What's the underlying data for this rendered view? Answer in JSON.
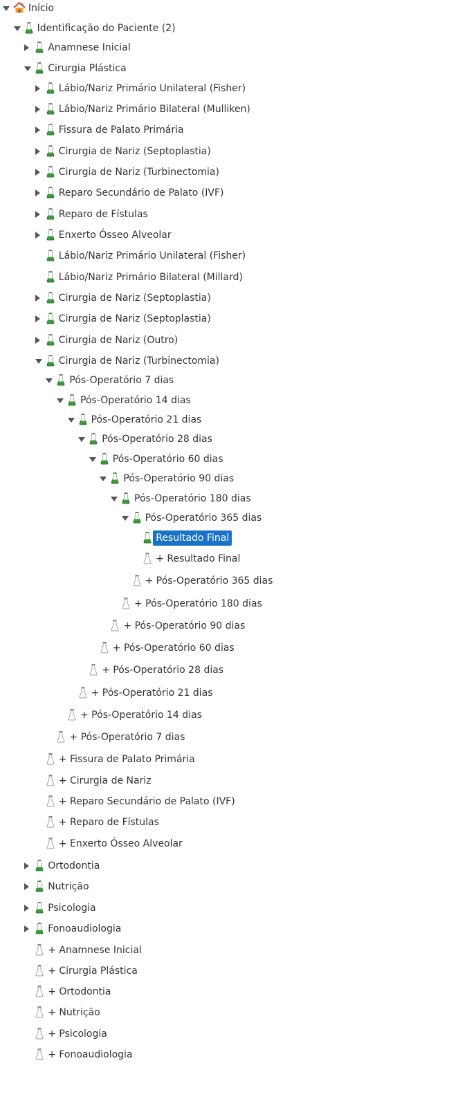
{
  "tree": {
    "rows": [
      {
        "label": "Início",
        "icon": "home-icon",
        "toggle": "expanded"
      },
      {
        "label": "Identificação do Paciente (2)",
        "icon": "flask-green-icon",
        "toggle": "expanded"
      },
      {
        "label": "Anamnese Inicial",
        "icon": "flask-green-icon",
        "toggle": "collapsed"
      },
      {
        "label": "Cirurgia Plástica",
        "icon": "flask-green-icon",
        "toggle": "expanded"
      },
      {
        "label": "Lábio/Nariz Primário Unilateral (Fisher)",
        "icon": "flask-green-icon",
        "toggle": "collapsed"
      },
      {
        "label": "Lábio/Nariz Primário Bilateral (Mulliken)",
        "icon": "flask-green-icon",
        "toggle": "collapsed"
      },
      {
        "label": "Fissura de Palato Primária",
        "icon": "flask-green-icon",
        "toggle": "collapsed"
      },
      {
        "label": "Cirurgia de Nariz (Septoplastia)",
        "icon": "flask-green-icon",
        "toggle": "collapsed"
      },
      {
        "label": "Cirurgia de Nariz (Turbinectomia)",
        "icon": "flask-green-icon",
        "toggle": "collapsed"
      },
      {
        "label": "Reparo Secundário de Palato (IVF)",
        "icon": "flask-green-icon",
        "toggle": "collapsed"
      },
      {
        "label": "Reparo de Fístulas",
        "icon": "flask-green-icon",
        "toggle": "collapsed"
      },
      {
        "label": "Enxerto Ósseo Alveolar",
        "icon": "flask-green-icon",
        "toggle": "collapsed"
      },
      {
        "label": "Lábio/Nariz Primário Unilateral (Fisher)",
        "icon": "flask-green-icon",
        "toggle": "none"
      },
      {
        "label": "Lábio/Nariz Primário Bilateral (Millard)",
        "icon": "flask-green-icon",
        "toggle": "none"
      },
      {
        "label": "Cirurgia de Nariz (Septoplastia)",
        "icon": "flask-green-icon",
        "toggle": "collapsed"
      },
      {
        "label": "Cirurgia de Nariz (Septoplastia)",
        "icon": "flask-green-icon",
        "toggle": "collapsed"
      },
      {
        "label": "Cirurgia de Nariz (Outro)",
        "icon": "flask-green-icon",
        "toggle": "collapsed"
      },
      {
        "label": "Cirurgia de Nariz (Turbinectomia)",
        "icon": "flask-green-icon",
        "toggle": "expanded"
      },
      {
        "label": "Pós-Operatório 7 dias",
        "icon": "flask-green-icon",
        "toggle": "expanded"
      },
      {
        "label": "Pós-Operatório 14 dias",
        "icon": "flask-green-icon",
        "toggle": "expanded"
      },
      {
        "label": "Pós-Operatório 21 dias",
        "icon": "flask-green-icon",
        "toggle": "expanded"
      },
      {
        "label": "Pós-Operatório 28 dias",
        "icon": "flask-green-icon",
        "toggle": "expanded"
      },
      {
        "label": "Pós-Operatório 60 dias",
        "icon": "flask-green-icon",
        "toggle": "expanded"
      },
      {
        "label": "Pós-Operatório 90 dias",
        "icon": "flask-green-icon",
        "toggle": "expanded"
      },
      {
        "label": "Pós-Operatório 180 dias",
        "icon": "flask-green-icon",
        "toggle": "expanded"
      },
      {
        "label": "Pós-Operatório 365 dias",
        "icon": "flask-green-icon",
        "toggle": "expanded"
      },
      {
        "label": "Resultado Final",
        "icon": "flask-green-icon",
        "toggle": "none",
        "selected": true
      },
      {
        "label": "+ Resultado Final",
        "icon": "flask-empty-icon",
        "toggle": "none"
      },
      {
        "label": "+ Pós-Operatório 365 dias",
        "icon": "flask-empty-icon",
        "toggle": "none"
      },
      {
        "label": "+ Pós-Operatório 180 dias",
        "icon": "flask-empty-icon",
        "toggle": "none"
      },
      {
        "label": "+ Pós-Operatório 90 dias",
        "icon": "flask-empty-icon",
        "toggle": "none"
      },
      {
        "label": "+ Pós-Operatório 60 dias",
        "icon": "flask-empty-icon",
        "toggle": "none"
      },
      {
        "label": "+ Pós-Operatório 28 dias",
        "icon": "flask-empty-icon",
        "toggle": "none"
      },
      {
        "label": "+ Pós-Operatório 21 dias",
        "icon": "flask-empty-icon",
        "toggle": "none"
      },
      {
        "label": "+ Pós-Operatório 14 dias",
        "icon": "flask-empty-icon",
        "toggle": "none"
      },
      {
        "label": "+ Pós-Operatório 7 dias",
        "icon": "flask-empty-icon",
        "toggle": "none"
      },
      {
        "label": "+ Fissura de Palato Primária",
        "icon": "flask-empty-icon",
        "toggle": "none"
      },
      {
        "label": "+ Cirurgia de Nariz",
        "icon": "flask-empty-icon",
        "toggle": "none"
      },
      {
        "label": "+ Reparo Secundário de Palato (IVF)",
        "icon": "flask-empty-icon",
        "toggle": "none"
      },
      {
        "label": "+ Reparo de Fístulas",
        "icon": "flask-empty-icon",
        "toggle": "none"
      },
      {
        "label": "+ Enxerto Ósseo Alveolar",
        "icon": "flask-empty-icon",
        "toggle": "none"
      },
      {
        "label": "Ortodontia",
        "icon": "flask-green-icon",
        "toggle": "collapsed"
      },
      {
        "label": "Nutrição",
        "icon": "flask-green-icon",
        "toggle": "collapsed"
      },
      {
        "label": "Psicologia",
        "icon": "flask-green-icon",
        "toggle": "collapsed"
      },
      {
        "label": "Fonoaudiologia",
        "icon": "flask-green-icon",
        "toggle": "collapsed"
      },
      {
        "label": "+ Anamnese Inicial",
        "icon": "flask-empty-icon",
        "toggle": "none"
      },
      {
        "label": "+ Cirurgia Plástica",
        "icon": "flask-empty-icon",
        "toggle": "none"
      },
      {
        "label": "+ Ortodontia",
        "icon": "flask-empty-icon",
        "toggle": "none"
      },
      {
        "label": "+ Nutrição",
        "icon": "flask-empty-icon",
        "toggle": "none"
      },
      {
        "label": "+ Psicologia",
        "icon": "flask-empty-icon",
        "toggle": "none"
      },
      {
        "label": "+ Fonoaudiologia",
        "icon": "flask-empty-icon",
        "toggle": "none"
      }
    ]
  },
  "colors": {
    "selection": "#1a73c8",
    "flask_green": "#3c9a3c",
    "flask_empty": "#b8b8b8",
    "home_roof": "#d9534f",
    "home_wall": "#f0a030"
  }
}
